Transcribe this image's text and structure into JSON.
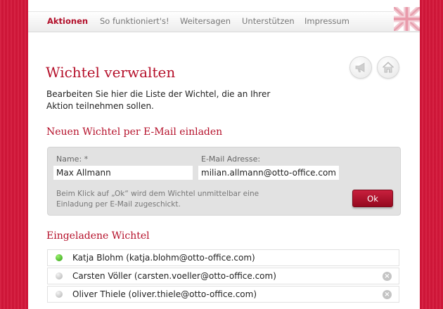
{
  "nav": {
    "items": [
      {
        "label": "Aktionen",
        "active": true
      },
      {
        "label": "So funktioniert's!",
        "active": false
      },
      {
        "label": "Weitersagen",
        "active": false
      },
      {
        "label": "Unterstützen",
        "active": false
      },
      {
        "label": "Impressum",
        "active": false
      }
    ],
    "language_icon": "uk-flag-icon"
  },
  "page": {
    "title": "Wichtel verwalten",
    "intro": "Bearbeiten Sie hier die Liste der Wichtel, die an Ihrer Aktion teilnehmen sollen.",
    "icons": [
      "megaphone-icon",
      "home-icon"
    ]
  },
  "invite": {
    "heading": "Neuen Wichtel per E-Mail einladen",
    "name_label": "Name: *",
    "name_value": "Max Allmann",
    "email_label": "E-Mail Adresse:",
    "email_value": "milian.allmann@otto-office.com",
    "hint": "Beim Klick auf „Ok“ wird dem Wichtel unmittelbar eine Einladung per E-Mail zugeschickt.",
    "ok_label": "Ok"
  },
  "invited": {
    "heading": "Eingeladene Wichtel",
    "rows": [
      {
        "text": "Katja Blohm (katja.blohm@otto-office.com)",
        "status": "green",
        "removable": false
      },
      {
        "text": "Carsten Völler (carsten.voeller@otto-office.com)",
        "status": "gray",
        "removable": true
      },
      {
        "text": "Oliver Thiele (oliver.thiele@otto-office.com)",
        "status": "gray",
        "removable": true
      }
    ],
    "remove_glyph": "×"
  },
  "colors": {
    "background": "#d4173a",
    "accent": "#b5102a",
    "ok_button": "#b0142f"
  }
}
